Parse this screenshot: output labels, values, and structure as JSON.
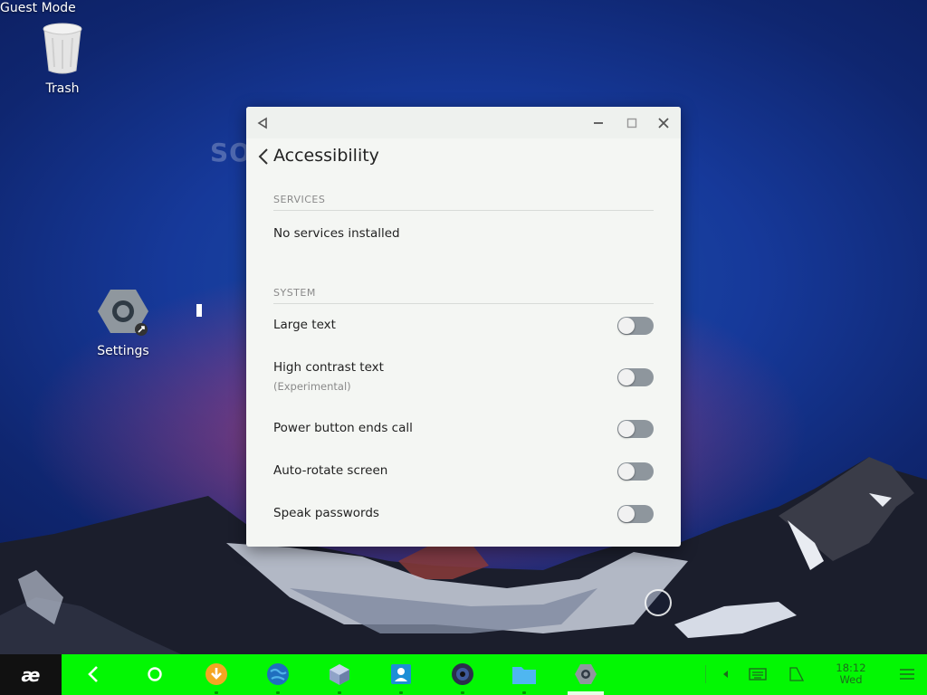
{
  "desktop": {
    "mode_label": "Guest Mode",
    "trash_label": "Trash",
    "settings_label": "Settings",
    "watermark": "SOFTPEDIA"
  },
  "window": {
    "title": "Accessibility",
    "sections": {
      "services": {
        "heading": "SERVICES",
        "empty_text": "No services installed"
      },
      "system": {
        "heading": "SYSTEM",
        "items": [
          {
            "label": "Large text",
            "sub": "",
            "on": false
          },
          {
            "label": "High contrast text",
            "sub": "(Experimental)",
            "on": false
          },
          {
            "label": "Power button ends call",
            "sub": "",
            "on": false
          },
          {
            "label": "Auto-rotate screen",
            "sub": "",
            "on": false
          },
          {
            "label": "Speak passwords",
            "sub": "",
            "on": false
          }
        ]
      }
    }
  },
  "taskbar": {
    "start_glyph": "æ",
    "apps": [
      "back-icon",
      "home-icon",
      "download-icon",
      "browser-icon",
      "cube-icon",
      "contacts-icon",
      "music-icon",
      "files-icon",
      "settings-icon"
    ],
    "clock": {
      "time": "18:12",
      "day": "Wed"
    },
    "colors": {
      "bar": "#03f703",
      "start": "#111111"
    }
  }
}
